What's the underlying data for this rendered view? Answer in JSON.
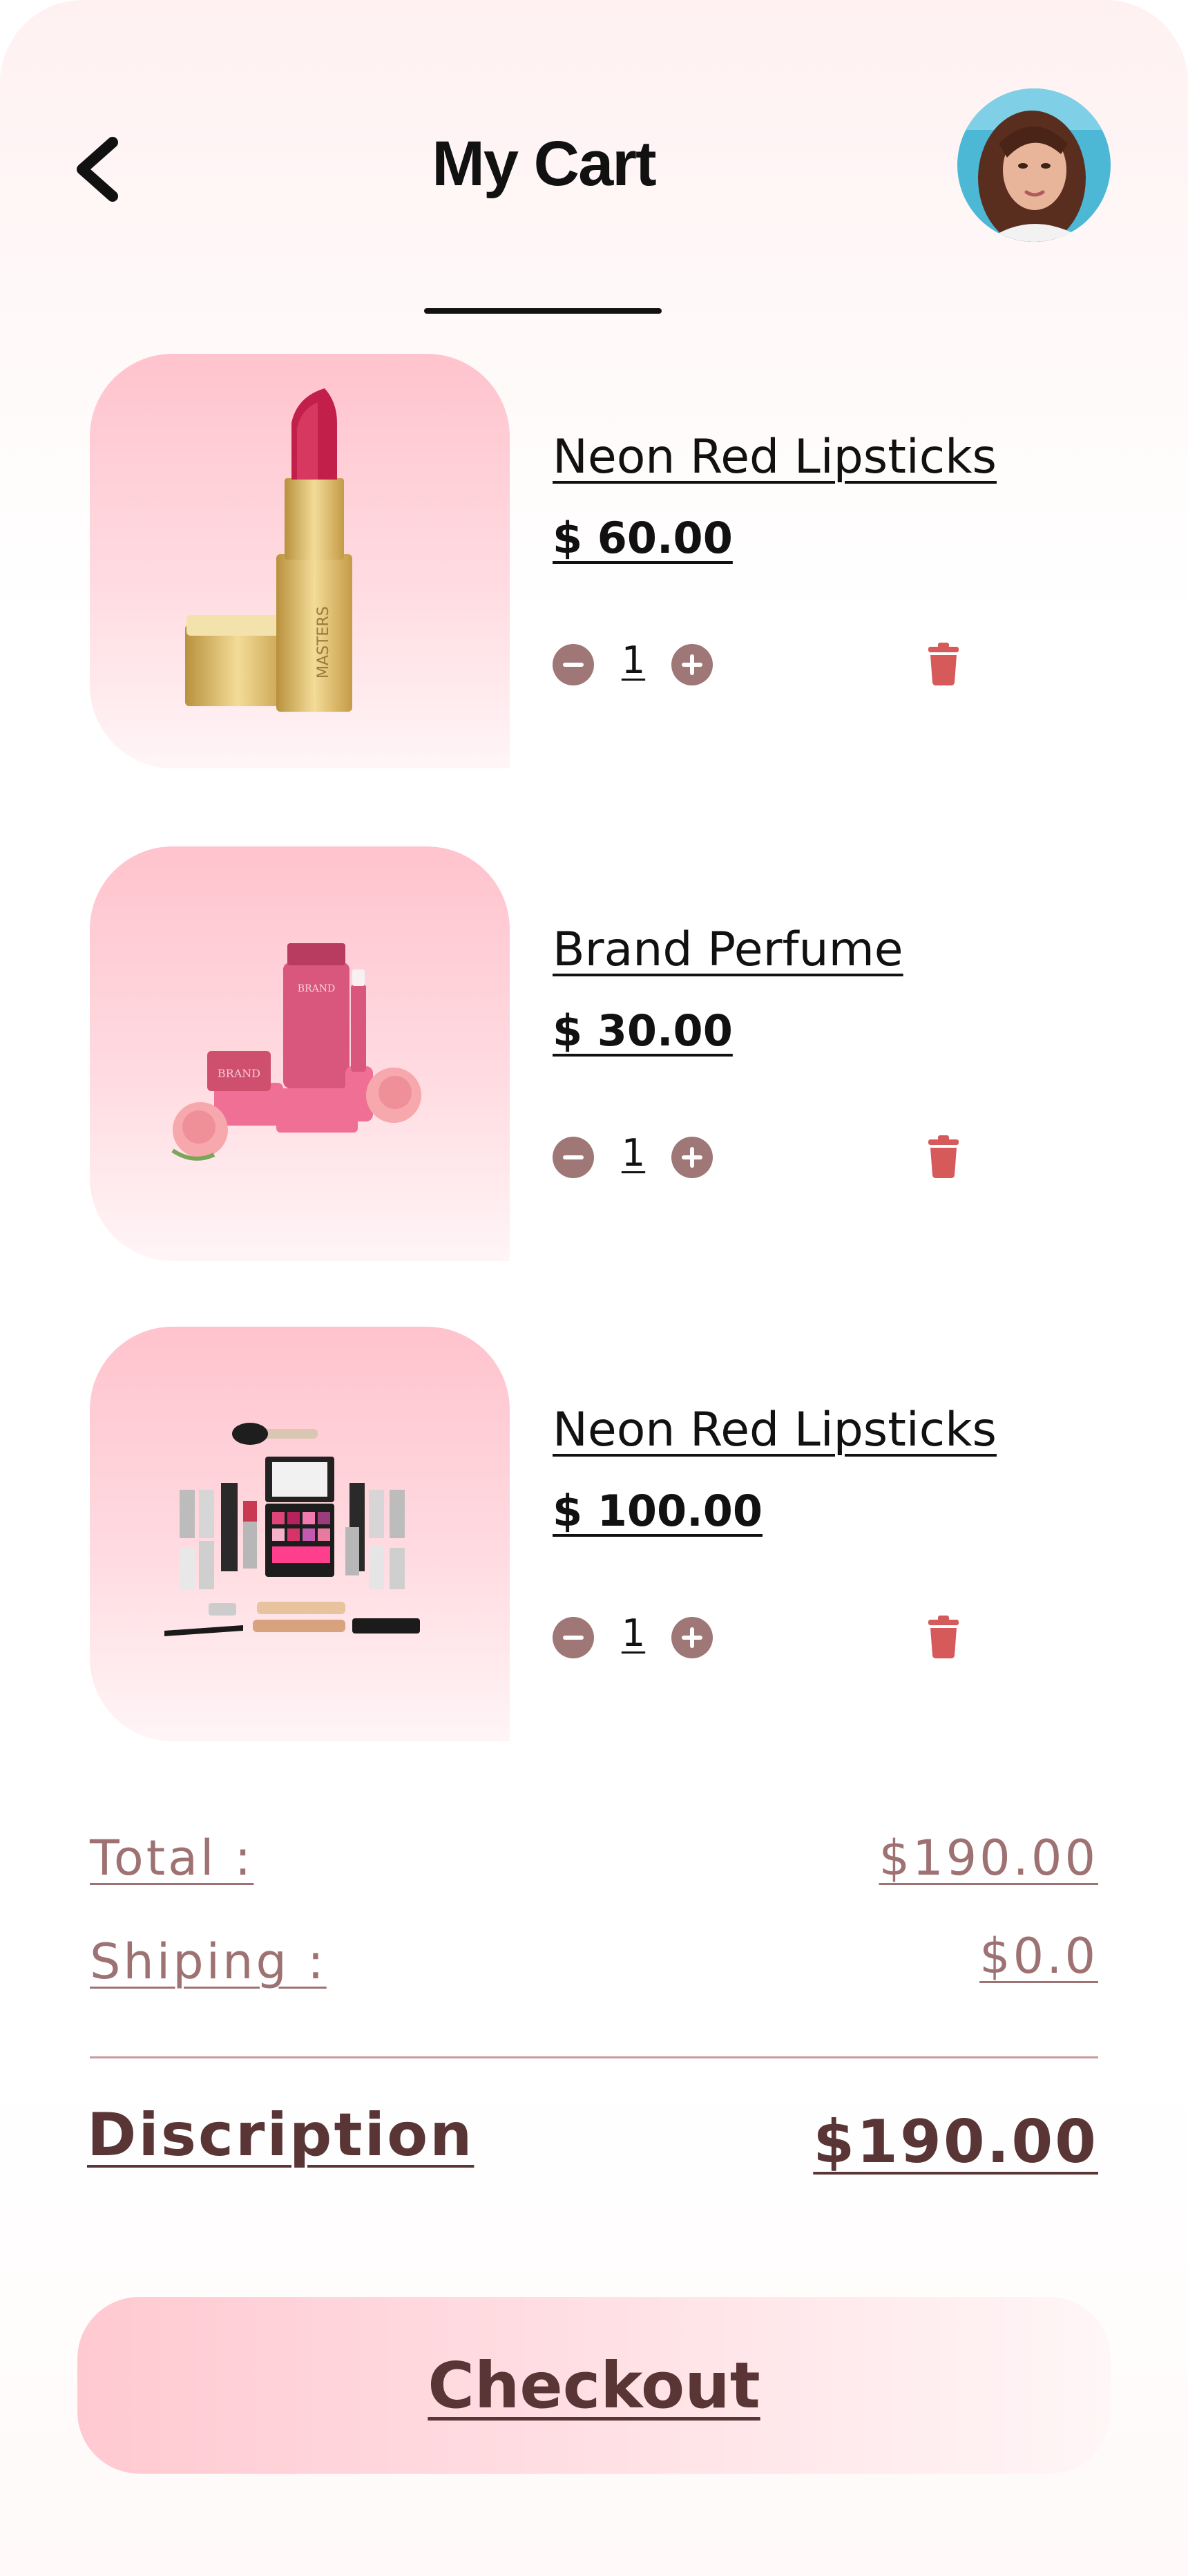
{
  "header": {
    "title": "My Cart",
    "back_icon": "chevron-left-icon",
    "avatar_alt": "user-avatar"
  },
  "cart": {
    "items": [
      {
        "name": "Neon Red Lipsticks",
        "price": "$ 60.00",
        "quantity": "1",
        "image": "lipstick-image"
      },
      {
        "name": "Brand Perfume",
        "price": "$ 30.00",
        "quantity": "1",
        "image": "perfume-set-image"
      },
      {
        "name": "Neon Red Lipsticks",
        "price": "$ 100.00",
        "quantity": "1",
        "image": "makeup-kit-image"
      }
    ]
  },
  "summary": {
    "total_label": "Total :",
    "total_value": "$190.00",
    "shipping_label": "Shiping :",
    "shipping_value": "$0.0",
    "grand_label": "Discription",
    "grand_value": "$190.00"
  },
  "checkout": {
    "label": "Checkout"
  },
  "colors": {
    "accent": "#9e7776",
    "summary_text": "#9e7272",
    "grand_text": "#5a3536",
    "delete": "#d65a5a",
    "thumb_top": "#ffc3cd"
  }
}
